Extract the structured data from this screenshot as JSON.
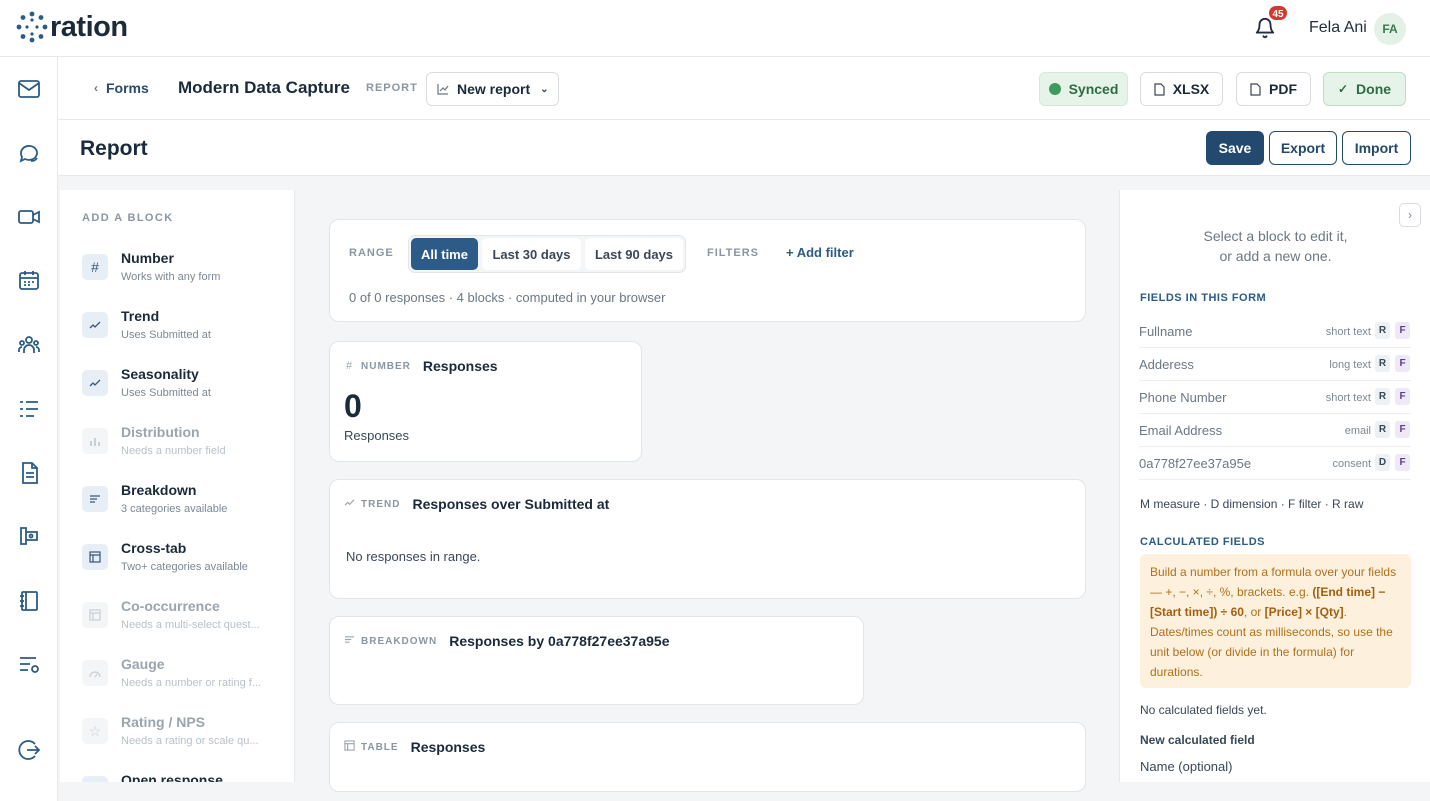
{
  "app": {
    "logo_text": "ration",
    "notifications_count": "45",
    "user_name": "Fela Ani",
    "user_initials": "FA"
  },
  "rail": [
    "mail-icon",
    "chat-icon",
    "video-icon",
    "calendar-icon",
    "people-icon",
    "list-icon",
    "document-icon",
    "book-icon",
    "notebook-icon",
    "settings-list-icon",
    "logout-icon"
  ],
  "subheader": {
    "breadcrumb": "Forms",
    "form_title": "Modern Data Capture",
    "report_tag": "REPORT",
    "report_select": "New report",
    "synced": "Synced",
    "xlsx": "XLSX",
    "pdf": "PDF",
    "done": "Done"
  },
  "titlebar": {
    "title": "Report",
    "save": "Save",
    "export": "Export",
    "import": "Import"
  },
  "palette": {
    "heading": "ADD A BLOCK",
    "items": [
      {
        "title": "Number",
        "sub": "Works with any form",
        "icon": "#",
        "enabled": true
      },
      {
        "title": "Trend",
        "sub": "Uses Submitted at",
        "icon": "trend-icon",
        "enabled": true
      },
      {
        "title": "Seasonality",
        "sub": "Uses Submitted at",
        "icon": "trend-icon",
        "enabled": true
      },
      {
        "title": "Distribution",
        "sub": "Needs a number field",
        "icon": "bars-icon",
        "enabled": false
      },
      {
        "title": "Breakdown",
        "sub": "3 categories available",
        "icon": "lines-icon",
        "enabled": true
      },
      {
        "title": "Cross-tab",
        "sub": "Two+ categories available",
        "icon": "table-icon",
        "enabled": true
      },
      {
        "title": "Co-occurrence",
        "sub": "Needs a multi-select quest...",
        "icon": "table-icon",
        "enabled": false
      },
      {
        "title": "Gauge",
        "sub": "Needs a number or rating f...",
        "icon": "gauge-icon",
        "enabled": false
      },
      {
        "title": "Rating / NPS",
        "sub": "Needs a rating or scale qu...",
        "icon": "star-icon",
        "enabled": false
      },
      {
        "title": "Open response",
        "sub": "",
        "icon": "quote-icon",
        "enabled": true
      }
    ]
  },
  "range": {
    "label": "RANGE",
    "options": [
      "All time",
      "Last 30 days",
      "Last 90 days"
    ],
    "selected": "All time",
    "filters_label": "FILTERS",
    "add_filter": "+ Add filter",
    "summary": "0 of 0 responses · 4 blocks · computed in your browser"
  },
  "blocks": {
    "number": {
      "kind": "NUMBER",
      "name": "Responses",
      "value": "0",
      "label": "Responses"
    },
    "trend": {
      "kind": "TREND",
      "name": "Responses over Submitted at",
      "empty": "No responses in range."
    },
    "breakdown": {
      "kind": "BREAKDOWN",
      "name": "Responses by 0a778f27ee37a95e"
    },
    "table": {
      "kind": "TABLE",
      "name": "Responses"
    }
  },
  "right_panel": {
    "hint_line1": "Select a block to edit it,",
    "hint_line2": "or add a new one.",
    "fields_heading": "FIELDS IN THIS FORM",
    "fields": [
      {
        "name": "Fullname",
        "type": "short text",
        "tag1": "R",
        "tag2": "F"
      },
      {
        "name": "Adderess",
        "type": "long text",
        "tag1": "R",
        "tag2": "F"
      },
      {
        "name": "Phone Number",
        "type": "short text",
        "tag1": "R",
        "tag2": "F"
      },
      {
        "name": "Email Address",
        "type": "email",
        "tag1": "R",
        "tag2": "F"
      },
      {
        "name": "0a778f27ee37a95e",
        "type": "consent",
        "tag1": "D",
        "tag2": "F"
      }
    ],
    "legend": "M measure · D dimension · F filter · R raw",
    "calc_heading": "CALCULATED FIELDS",
    "calc_text_1": "Build a number from a formula over your fields — +, −, ×, ÷, %, brackets. e.g. ",
    "calc_example_1": "([End time] − [Start time]) ÷ 60",
    "calc_text_2": ", or ",
    "calc_example_2": "[Price] × [Qty]",
    "calc_text_3": ". Dates/times count as milliseconds, so use the unit below (or divide in the formula) for durations.",
    "no_calc": "No calculated fields yet.",
    "new_calc": "New calculated field",
    "name_optional": "Name (optional)"
  }
}
